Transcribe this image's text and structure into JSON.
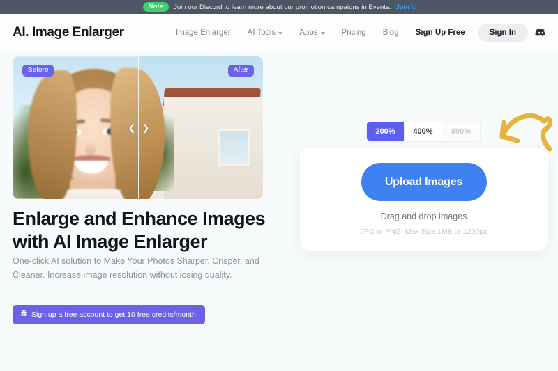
{
  "banner": {
    "badge": "Note",
    "text": "Join our Discord to learn more about our promotion campaigns in Events.",
    "link": "Join it",
    "badge_color": "#3ecf6e",
    "bg_color": "#4c5764",
    "link_color": "#4a9ff5"
  },
  "header": {
    "logo": "AI. Image Enlarger",
    "nav": [
      {
        "label": "Image Enlarger",
        "has_caret": false
      },
      {
        "label": "AI Tools",
        "has_caret": true
      },
      {
        "label": "Apps",
        "has_caret": true
      },
      {
        "label": "Pricing",
        "has_caret": false
      },
      {
        "label": "Blog",
        "has_caret": false
      },
      {
        "label": "Sign Up Free",
        "has_caret": false
      }
    ],
    "sign_in": "Sign In",
    "discord_icon": "discord-icon"
  },
  "hero": {
    "badge_before": "Before",
    "badge_after": "After",
    "headline": "Enlarge and Enhance Images with AI Image Enlarger",
    "subtitle": "One-click AI solution to Make Your Photos Sharper, Crisper, and Cleaner. Increase image resolution without losing quality.",
    "credits_button": "Sign up a free account to get 10 free credits/month",
    "credits_icon": "gift-icon",
    "badge_color": "#6a63e8",
    "handle_left_icon": "chevron-left-icon",
    "handle_right_icon": "chevron-right-icon"
  },
  "upload": {
    "scales": [
      {
        "label": "200%",
        "state": "active"
      },
      {
        "label": "400%",
        "state": "normal"
      },
      {
        "label": "800%",
        "state": "disabled"
      }
    ],
    "button": "Upload Images",
    "drag_text": "Drag and drop images",
    "hint_text": "JPG or PNG. Max Size 1MB or 1200px",
    "button_color": "#3d82f0",
    "active_scale_color": "#5b5ef0",
    "arrow_icon": "curved-arrow-icon",
    "arrow_color": "#e6b43c"
  }
}
